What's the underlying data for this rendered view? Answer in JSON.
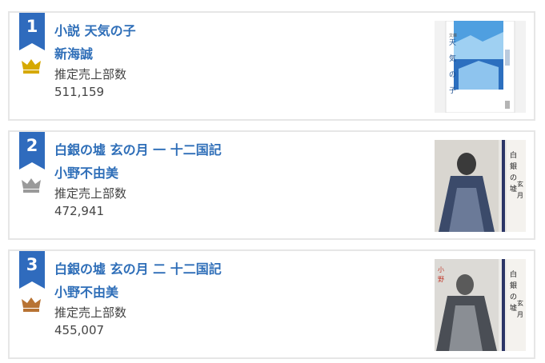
{
  "ranking": [
    {
      "rank": "1",
      "title": "小説 天気の子",
      "author": "新海誠",
      "sales_label": "推定売上部数",
      "sales": "511,159",
      "crown": "gold-crown-icon",
      "crown_color": "#d6a900",
      "cover": "book-cover-tenki-no-ko"
    },
    {
      "rank": "2",
      "title": "白銀の墟 玄の月 一 十二国記",
      "author": "小野不由美",
      "sales_label": "推定売上部数",
      "sales": "472,941",
      "crown": "silver-crown-icon",
      "crown_color": "#9a9a9a",
      "cover": "book-cover-hakugin-1"
    },
    {
      "rank": "3",
      "title": "白銀の墟 玄の月 二 十二国記",
      "author": "小野不由美",
      "sales_label": "推定売上部数",
      "sales": "455,007",
      "crown": "bronze-crown-icon",
      "crown_color": "#b87333",
      "cover": "book-cover-hakugin-2"
    }
  ],
  "accent_color": "#2e6eb8",
  "badge_color": "#2f6bbd"
}
